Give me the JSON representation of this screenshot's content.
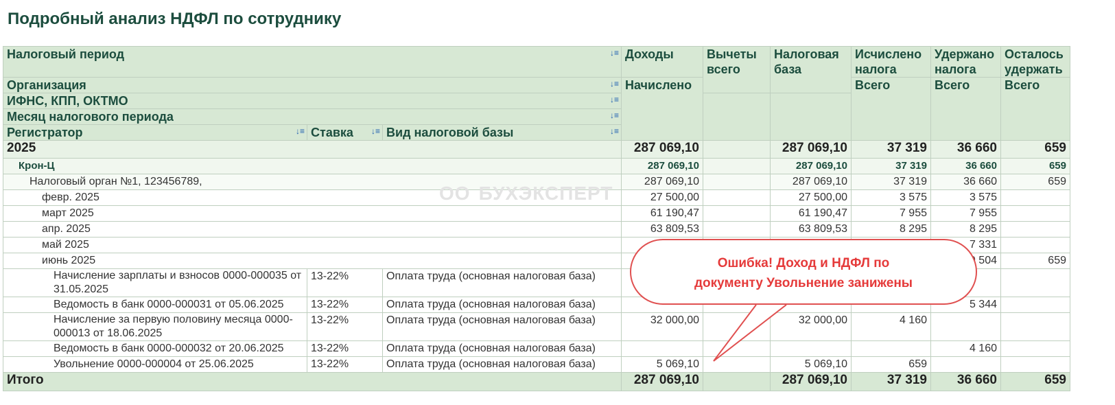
{
  "title": "Подробный анализ НДФЛ по сотруднику",
  "headers": {
    "tax_period": "Налоговый период",
    "organization": "Организация",
    "ifns": "ИФНС, КПП, ОКТМО",
    "month": "Месяц налогового периода",
    "registrar": "Регистратор",
    "rate": "Ставка",
    "base_type": "Вид налоговой базы",
    "income": "Доходы",
    "income_sub": "Начислено",
    "deductions": "Вычеты всего",
    "tax_base": "Налоговая база",
    "calculated": "Исчислено налога",
    "calculated_sub": "Всего",
    "withheld": "Удержано налога",
    "withheld_sub": "Всего",
    "remaining": "Осталось удержать",
    "remaining_sub": "Всего"
  },
  "year": {
    "label": "2025",
    "income": "287 069,10",
    "deductions": "",
    "base": "287 069,10",
    "calculated": "37 319",
    "withheld": "36 660",
    "remaining": "659"
  },
  "org": {
    "label": "Крон-Ц",
    "income": "287 069,10",
    "deductions": "",
    "base": "287 069,10",
    "calculated": "37 319",
    "withheld": "36 660",
    "remaining": "659"
  },
  "ifns": {
    "label": "Налоговый орган №1, 123456789,",
    "income": "287 069,10",
    "deductions": "",
    "base": "287 069,10",
    "calculated": "37 319",
    "withheld": "36 660",
    "remaining": "659"
  },
  "months": [
    {
      "label": "февр. 2025",
      "income": "27 500,00",
      "deductions": "",
      "base": "27 500,00",
      "calculated": "3 575",
      "withheld": "3 575",
      "remaining": ""
    },
    {
      "label": "март 2025",
      "income": "61 190,47",
      "deductions": "",
      "base": "61 190,47",
      "calculated": "7 955",
      "withheld": "7 955",
      "remaining": ""
    },
    {
      "label": "апр. 2025",
      "income": "63 809,53",
      "deductions": "",
      "base": "63 809,53",
      "calculated": "8 295",
      "withheld": "8 295",
      "remaining": ""
    },
    {
      "label": "май 2025",
      "income": "",
      "deductions": "",
      "base": "",
      "calculated": "",
      "withheld": "7 331",
      "remaining": ""
    },
    {
      "label": "июнь 2025",
      "income": "",
      "deductions": "",
      "base": "",
      "calculated": "",
      "withheld": "9 504",
      "remaining": "659"
    }
  ],
  "docs": [
    {
      "name": "Начисление зарплаты и взносов 0000-000035 от 31.05.2025",
      "rate": "13-22%",
      "type": "Оплата труда (основная налоговая база)",
      "income": "",
      "deductions": "",
      "base": "",
      "calculated": "",
      "withheld": "",
      "remaining": ""
    },
    {
      "name": "Ведомость в банк 0000-000031 от 05.06.2025",
      "rate": "13-22%",
      "type": "Оплата труда (основная налоговая база)",
      "income": "",
      "deductions": "",
      "base": "",
      "calculated": "",
      "withheld": "5 344",
      "remaining": ""
    },
    {
      "name": "Начисление за первую половину месяца 0000-000013 от 18.06.2025",
      "rate": "13-22%",
      "type": "Оплата труда (основная налоговая база)",
      "income": "32 000,00",
      "deductions": "",
      "base": "32 000,00",
      "calculated": "4 160",
      "withheld": "",
      "remaining": ""
    },
    {
      "name": "Ведомость в банк 0000-000032 от 20.06.2025",
      "rate": "13-22%",
      "type": "Оплата труда (основная налоговая база)",
      "income": "",
      "deductions": "",
      "base": "",
      "calculated": "",
      "withheld": "4 160",
      "remaining": ""
    },
    {
      "name": "Увольнение 0000-000004 от 25.06.2025",
      "rate": "13-22%",
      "type": "Оплата труда (основная налоговая база)",
      "income": "5 069,10",
      "deductions": "",
      "base": "5 069,10",
      "calculated": "659",
      "withheld": "",
      "remaining": ""
    }
  ],
  "total": {
    "label": "Итого",
    "income": "287 069,10",
    "deductions": "",
    "base": "287 069,10",
    "calculated": "37 319",
    "withheld": "36 660",
    "remaining": "659"
  },
  "watermark": {
    "logo": "ОО",
    "text": "БУХЭКСПЕРТ"
  },
  "callout": {
    "line1": "Ошибка! Доход и НДФЛ по",
    "line2": "документу Увольнение занижены"
  },
  "icons": {
    "sort": "sort-icon"
  },
  "colors": {
    "header_bg": "#d7e8d4",
    "header_text": "#1c4d3e",
    "callout": "#e53a3a"
  }
}
